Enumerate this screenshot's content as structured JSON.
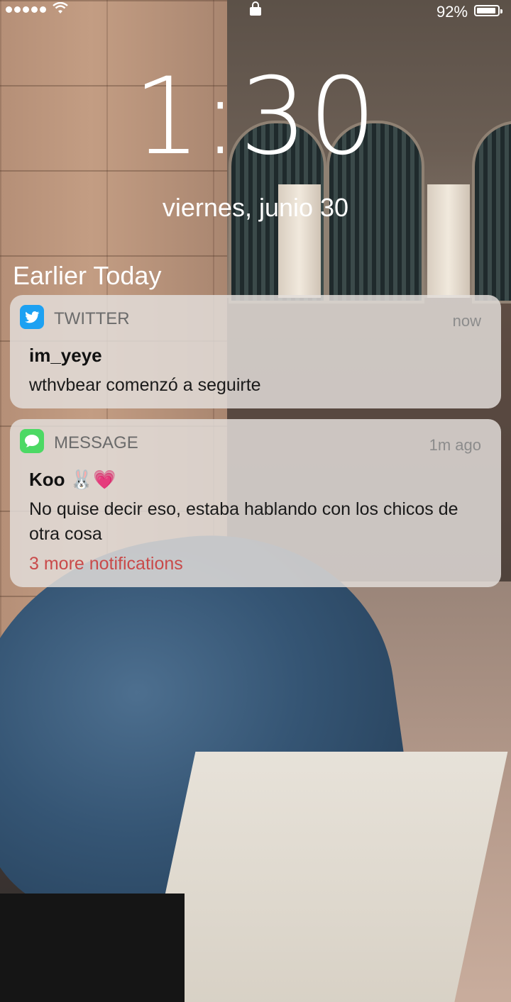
{
  "status_bar": {
    "signal_dots": 5,
    "battery_percent": "92%",
    "battery_level": 0.92
  },
  "lockscreen": {
    "time": "1:30",
    "date": "viernes, junio 30"
  },
  "notifications_section_title": "Earlier Today",
  "notifications": [
    {
      "app": "TWITTER",
      "icon": "twitter-bird-icon",
      "time": "now",
      "sender": "im_yeye",
      "body": "wthvbear comenzó a seguirte"
    },
    {
      "app": "MESSAGE",
      "icon": "message-bubble-icon",
      "time": "1m ago",
      "sender": "Koo 🐰💗",
      "body": "No quise decir eso, estaba hablando con los chicos de otra cosa",
      "more": "3 more notifications"
    }
  ],
  "colors": {
    "twitter": "#1da1f2",
    "messages": "#4cd964",
    "more_link": "#c94a4a"
  }
}
